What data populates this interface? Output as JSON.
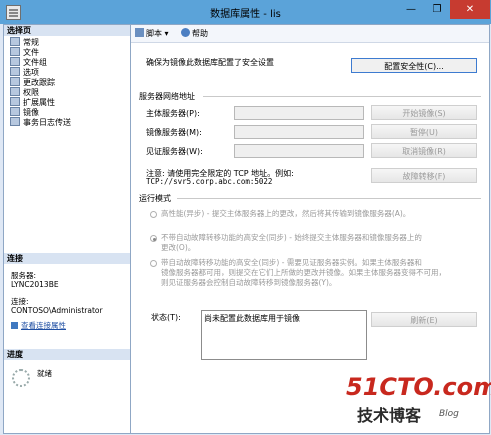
{
  "window": {
    "title": "数据库属性 - lis",
    "controls": [
      "—",
      "❐",
      "✕"
    ]
  },
  "left": {
    "select_page_title": "选择页",
    "pages": [
      "常规",
      "文件",
      "文件组",
      "选项",
      "更改跟踪",
      "权限",
      "扩展属性",
      "镜像",
      "事务日志传送"
    ],
    "connection_title": "连接",
    "server_label": "服务器:",
    "server_value": "LYNC2013BE",
    "connection_label": "连接:",
    "connection_value": "CONTOSO\\Administrator",
    "view_props_link": "查看连接属性",
    "progress_title": "进度",
    "progress_status": "就绪"
  },
  "toolbar": {
    "script_label": "脚本",
    "help_label": "帮助"
  },
  "mirroring": {
    "intro": "确保为镜像此数据库配置了安全设置",
    "configure_security_button": "配置安全性(C)...",
    "server_addresses_title": "服务器网络地址",
    "principal_label": "主体服务器(P):",
    "mirror_label": "镜像服务器(M):",
    "witness_label": "见证服务器(W):",
    "principal_value": "",
    "mirror_value": "",
    "witness_value": "",
    "start_button": "开始镜像(S)",
    "pause_button": "暂停(U)",
    "remove_button": "取消镜像(R)",
    "failover_button": "故障转移(F)",
    "note_line1": "注意: 请使用完全限定的 TCP 地址。例如:",
    "note_line2": "TCP://svr5.corp.abc.com:5022",
    "operating_mode_title": "运行模式",
    "mode_high_perf": "高性能(异步) - 提交主体服务器上的更改，然后将其传输到镜像服务器(A)。",
    "mode_high_safety_line1": "不带自动故障转移功能的高安全(同步) - 始终提交主体服务器和镜像服务器上的",
    "mode_high_safety_line2": "更改(O)。",
    "mode_auto_failover_line1": "带自动故障转移功能的高安全(同步) - 需要见证服务器实例。如果主体服务器和",
    "mode_auto_failover_line2": "镜像服务器都可用，则提交在它们上所做的更改并镜像。如果主体服务器变得不可用，",
    "mode_auto_failover_line3": "则见证服务器会控制自动故障转移到镜像服务器(Y)。",
    "status_label": "状态(T):",
    "status_value": "尚未配置此数据库用于镜像",
    "refresh_button": "刷新(E)"
  },
  "watermark": {
    "line1": "51CTO.com",
    "line2": "技术博客",
    "line3": "Blog"
  },
  "colors": {
    "titlebar": "#5ba3d9",
    "close": "#c73b30",
    "panel_header": "#d8e3f2",
    "watermark_red": "#c8281e"
  }
}
